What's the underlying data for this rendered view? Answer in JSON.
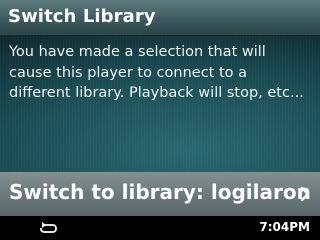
{
  "header": {
    "title": "Switch Library"
  },
  "message": {
    "text": "You have made a selection that will cause this player to connect to a different library. Playback will stop, etc..."
  },
  "action": {
    "label": "Switch to library: logilaron",
    "icon": "chevron-right-icon"
  },
  "status_bar": {
    "repeat_icon": "repeat-icon",
    "time": "7:04PM"
  }
}
